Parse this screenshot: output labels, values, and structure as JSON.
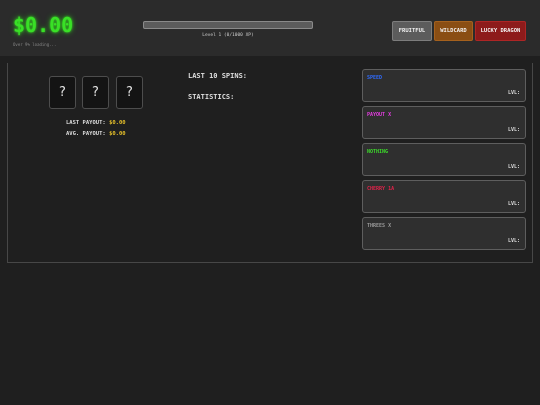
{
  "header": {
    "balance": "$0.00",
    "balance_subtext": "Over 9% loading...",
    "xp_label": "Level 1 (0/1000 XP)",
    "xp_fraction": 0.0
  },
  "modes": [
    {
      "label": "FRUITFUL",
      "color": "#5c5c5c"
    },
    {
      "label": "WILDCARD",
      "color": "#8a4e13"
    },
    {
      "label": "LUCKY DRAGON",
      "color": "#8d1b1b"
    }
  ],
  "reels": [
    "?",
    "?",
    "?"
  ],
  "payouts": {
    "last_label": "LAST PAYOUT:",
    "last_value": "$0.00",
    "avg_label": "AVG. PAYOUT:",
    "avg_value": "$0.00"
  },
  "stats": {
    "last_spins_label": "LAST 10 SPINS:",
    "statistics_label": "STATISTICS:"
  },
  "upgrades": [
    {
      "name": "SPEED",
      "level_label": "LVL:",
      "color": "#2f6bff"
    },
    {
      "name": "PAYOUT X",
      "level_label": "LVL:",
      "color": "#e33ce0"
    },
    {
      "name": "NOTHING",
      "level_label": "LVL:",
      "color": "#3ddc2b"
    },
    {
      "name": "CHERRY 1A",
      "level_label": "LVL:",
      "color": "#e1234a"
    },
    {
      "name": "THREES X",
      "level_label": "LVL:",
      "color": "#9a9a9a"
    }
  ]
}
